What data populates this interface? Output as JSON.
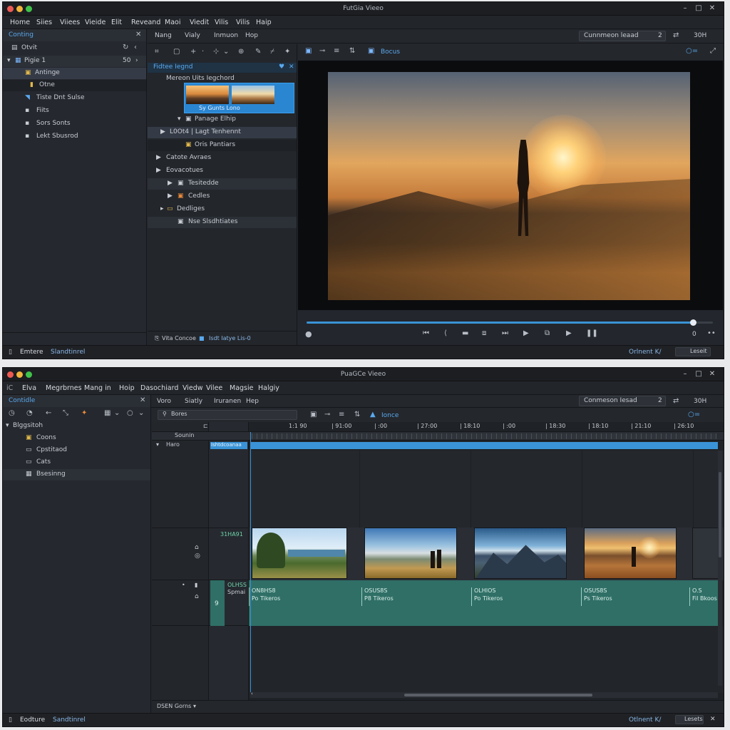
{
  "window1": {
    "title": "FutGia Vieeo",
    "menu": [
      "Home",
      "Siies",
      "Viiees",
      "Vieide",
      "Elit",
      "Reveand",
      "Maoi",
      "Viedit",
      "Vilis",
      "Vilis",
      "Haip"
    ],
    "search_label": "Cunnmeon leaad",
    "search_count": "2",
    "zoom": "30H",
    "left_panel": {
      "title": "Conting",
      "section": "Otvit",
      "project": "Pigie 1",
      "project_count": "50",
      "items": [
        "Antinge",
        "Otne",
        "Tiste Dnt Sulse",
        "Fiits",
        "Sors Sonts",
        "Lekt Sbusrod"
      ]
    },
    "tabs": [
      "Nang",
      "Vialy",
      "Inmuon",
      "Hop"
    ],
    "browser": {
      "title": "Fidtee Iegnd",
      "subtitle": "Mereon Uits Iegchord",
      "clip_label": "Sy Gunts Lono",
      "rows": [
        "Panage Elhip",
        "L0Ot4 | Lagt Tenhennt",
        "Oris Pantiars",
        "Catote Avraes",
        "Eovacotues",
        "Tesitedde",
        "Cedles",
        "Dedliges",
        "Nse Slsdhtiates"
      ],
      "footer_left": "Vita Concoe",
      "footer_right": "Isdt Iatye Lis-0"
    },
    "viewer": {
      "toolbar_label": "Bocus",
      "time": "0",
      "progress": 0.95
    },
    "status": {
      "left": "Emtere",
      "left2": "Slandtinrel",
      "right": "Orlnent K/",
      "right2": "Leseit"
    }
  },
  "window2": {
    "title": "PuaGCe Vieeo",
    "menu": [
      "Elva",
      "Megrbrnes",
      "Mang in",
      "Hoip",
      "Dasochiard",
      "Viedw",
      "Vilee",
      "Magsie",
      "Halgiy"
    ],
    "search_label": "Conmeson Iesad",
    "search_count": "2",
    "zoom": "30H",
    "left_panel": {
      "title": "Contidle",
      "section": "Blggsitoh",
      "items": [
        "Coons",
        "Cpstitaod",
        "Cats",
        "Bsesinng"
      ]
    },
    "tabs": [
      "Voro",
      "Siatly",
      "Iruranen",
      "Hep"
    ],
    "timeline": {
      "search_placeholder": "Bores",
      "toolbar_label": "Ionce",
      "ruler": [
        "1:1 90",
        "| 91:00",
        "| :00",
        "| 27:00",
        "| 18:10",
        "| :00",
        "| 18:30",
        "| 18:10",
        "| 21:10",
        "| 26:10"
      ],
      "track_header": "Sounin",
      "track_label": "Haro",
      "clip_bar": "Ishtdcoanaa",
      "video_track_label": "31HA91",
      "audio_track_label": "OLHSS",
      "audio_track_sub": "Spmai",
      "audio_num": "9",
      "audio_segments": [
        {
          "code": "ON8HS8",
          "name": "Po Tikeros"
        },
        {
          "code": "OSUS8S",
          "name": "P8 Tikeros"
        },
        {
          "code": "OLHIOS",
          "name": "Po Tikeros"
        },
        {
          "code": "OSUS8S",
          "name": "Ps Tikeros"
        },
        {
          "code": "O.S",
          "name": "Fil Bkoos"
        }
      ],
      "footer_label": "DSEN Gorns"
    },
    "status": {
      "left": "Eodture",
      "left2": "Sandtinrel",
      "right": "Otlnent K/",
      "right2": "Lesets"
    }
  },
  "colors": {
    "accent": "#3a93d6",
    "panel": "#25282e",
    "audio": "#2f6f66"
  }
}
